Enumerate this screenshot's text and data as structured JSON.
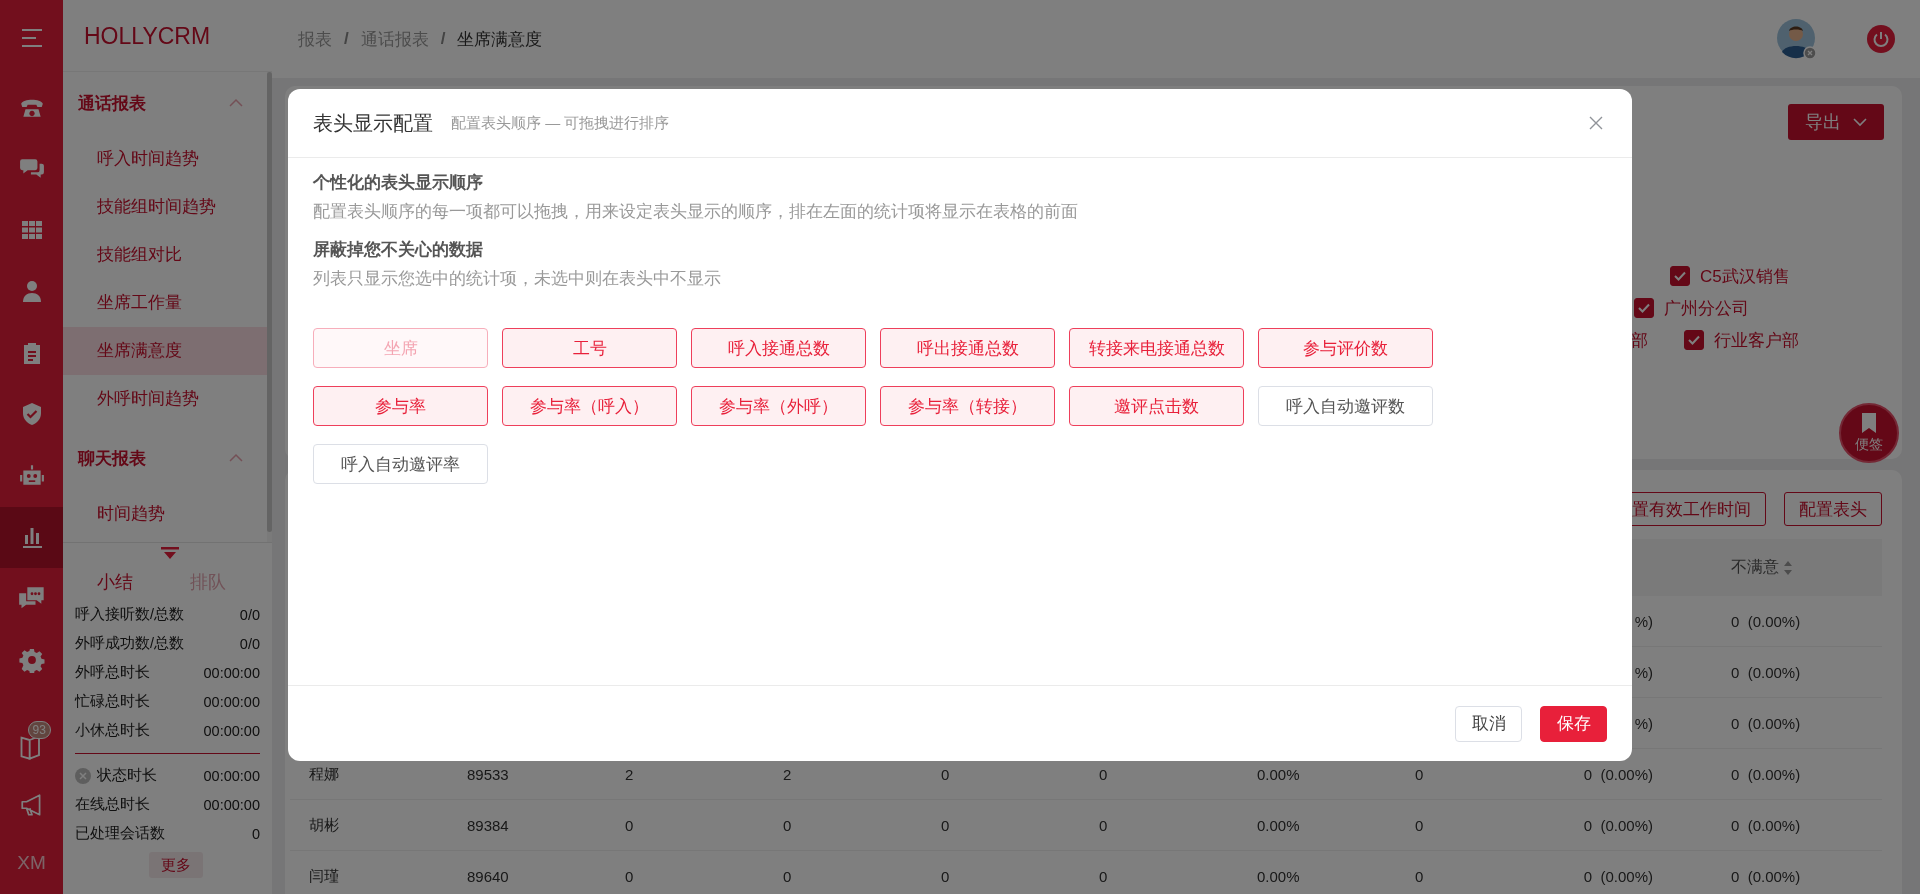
{
  "rail": {
    "items": [
      {
        "selected": false
      },
      {
        "selected": false
      },
      {
        "selected": false
      },
      {
        "selected": false
      },
      {
        "selected": false
      },
      {
        "selected": false
      },
      {
        "selected": false
      },
      {
        "selected": true
      },
      {
        "selected": false
      },
      {
        "selected": false
      }
    ],
    "bottom": [
      {
        "kind": "icon",
        "badge": "93"
      },
      {
        "kind": "icon"
      },
      {
        "kind": "text",
        "label": "XM"
      }
    ]
  },
  "sidebar": {
    "logo": "HOLLYCRM",
    "groups": [
      {
        "title": "通话报表",
        "expanded": true,
        "items": [
          {
            "label": "呼入时间趋势",
            "selected": false
          },
          {
            "label": "技能组时间趋势",
            "selected": false
          },
          {
            "label": "技能组对比",
            "selected": false
          },
          {
            "label": "坐席工作量",
            "selected": false
          },
          {
            "label": "坐席满意度",
            "selected": true
          },
          {
            "label": "外呼时间趋势",
            "selected": false
          }
        ]
      },
      {
        "title": "聊天报表",
        "expanded": true,
        "items": [
          {
            "label": "时间趋势",
            "selected": false
          }
        ]
      }
    ]
  },
  "summary": {
    "tabs": [
      {
        "label": "小结",
        "selected": true
      },
      {
        "label": "排队",
        "selected": false
      }
    ],
    "stats": [
      {
        "label": "呼入接听数/总数",
        "value": "0/0"
      },
      {
        "label": "外呼成功数/总数",
        "value": "0/0"
      },
      {
        "label": "外呼总时长",
        "value": "00:00:00"
      },
      {
        "label": "忙碌总时长",
        "value": "00:00:00"
      },
      {
        "label": "小休总时长",
        "value": "00:00:00"
      }
    ],
    "status_stats": [
      {
        "kind": "status",
        "label": "状态时长",
        "value": "00:00:00"
      },
      {
        "kind": "plain",
        "label": "在线总时长",
        "value": "00:00:00"
      },
      {
        "kind": "plain",
        "label": "已处理会话数",
        "value": "0"
      }
    ],
    "more": "更多"
  },
  "header": {
    "separator": "/",
    "breadcrumb": [
      {
        "label": "报表",
        "current": false
      },
      {
        "label": "通话报表",
        "current": false
      },
      {
        "label": "坐席满意度",
        "current": true
      }
    ]
  },
  "filter": {
    "export_button": "导出",
    "departments": [
      {
        "label": "C5武汉销售",
        "checked": true
      },
      {
        "label": "广州分公司",
        "checked": true
      }
    ],
    "partial_label": "部",
    "last_department": {
      "label": "行业客户部",
      "checked": true
    }
  },
  "notes_button": "便签",
  "table": {
    "toolbar": [
      "置有效工作时间",
      "配置表头"
    ],
    "header": {
      "column_10": "不满意"
    },
    "rows": [
      {
        "column_9": "%)",
        "column_10": "0  (0.00%)"
      },
      {
        "column_9": "%)",
        "column_10": "0  (0.00%)"
      },
      {
        "column_9": "%)",
        "column_10": "0  (0.00%)"
      },
      {
        "column_1": "程娜",
        "column_2": "89533",
        "column_3": "2",
        "column_4": "2",
        "column_5": "0",
        "column_6": "0",
        "column_7": "0.00%",
        "column_8": "0",
        "column_9": "0  (0.00%)",
        "column_10": "0  (0.00%)"
      },
      {
        "column_1": "胡彬",
        "column_2": "89384",
        "column_3": "0",
        "column_4": "0",
        "column_5": "0",
        "column_6": "0",
        "column_7": "0.00%",
        "column_8": "0",
        "column_9": "0  (0.00%)",
        "column_10": "0  (0.00%)"
      },
      {
        "column_1": "闫瑾",
        "column_2": "89640",
        "column_3": "0",
        "column_4": "0",
        "column_5": "0",
        "column_6": "0",
        "column_7": "0.00%",
        "column_8": "0",
        "column_9": "0  (0.00%)",
        "column_10": "0  (0.00%)"
      }
    ]
  },
  "modal": {
    "title": "表头显示配置",
    "subtitle": "配置表头顺序 — 可拖拽进行排序",
    "sections": [
      {
        "heading": "个性化的表头显示顺序",
        "text": "配置表头顺序的每一项都可以拖拽，用来设定表头显示的顺序，排在左面的统计项将显示在表格的前面"
      },
      {
        "heading": "屏蔽掉您不关心的数据",
        "text": "列表只显示您选中的统计项，未选中则在表头中不显示"
      }
    ],
    "columns": [
      {
        "label": "坐席",
        "selected": true,
        "disabled": true
      },
      {
        "label": "工号",
        "selected": true,
        "disabled": false
      },
      {
        "label": "呼入接通总数",
        "selected": true,
        "disabled": false
      },
      {
        "label": "呼出接通总数",
        "selected": true,
        "disabled": false
      },
      {
        "label": "转接来电接通总数",
        "selected": true,
        "disabled": false
      },
      {
        "label": "参与评价数",
        "selected": true,
        "disabled": false
      },
      {
        "label": "参与率",
        "selected": true,
        "disabled": false
      },
      {
        "label": "参与率（呼入）",
        "selected": true,
        "disabled": false
      },
      {
        "label": "参与率（外呼）",
        "selected": true,
        "disabled": false
      },
      {
        "label": "参与率（转接）",
        "selected": true,
        "disabled": false
      },
      {
        "label": "邀评点击数",
        "selected": true,
        "disabled": false
      },
      {
        "label": "呼入自动邀评数",
        "selected": false,
        "disabled": false
      },
      {
        "label": "呼入自动邀评率",
        "selected": false,
        "disabled": false
      }
    ],
    "buttons": [
      {
        "label": "取消",
        "kind": "default"
      },
      {
        "label": "保存",
        "kind": "primary"
      }
    ]
  }
}
